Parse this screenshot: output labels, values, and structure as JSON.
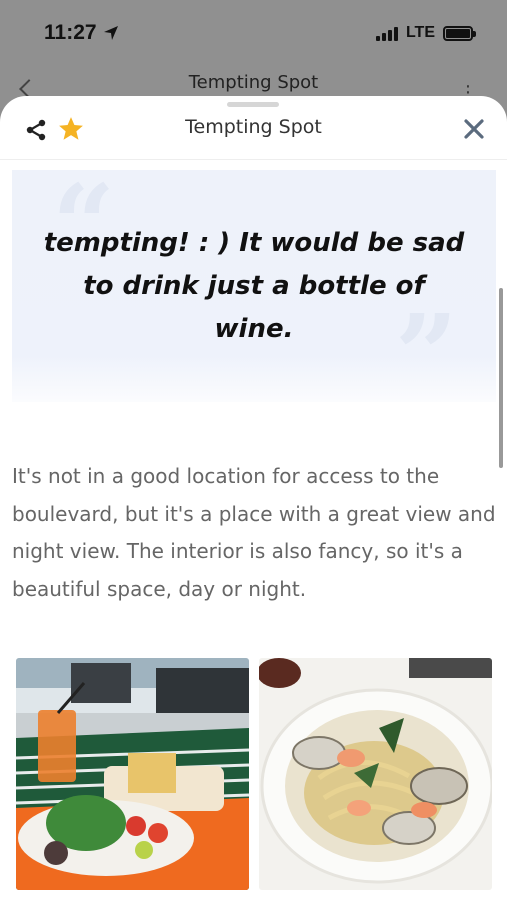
{
  "status_bar": {
    "time": "11:27",
    "network": "LTE"
  },
  "underlying_page": {
    "title": "Tempting Spot"
  },
  "sheet": {
    "title": "Tempting Spot",
    "share_icon": "share-icon",
    "favorite_icon": "star-icon",
    "close_icon": "close-icon",
    "accent_color": "#f5b324"
  },
  "review": {
    "quote": "tempting! : ) It would be sad to drink just a bottle of wine.",
    "description": "It's not in a good location for access to the boulevard, but it's a place with a great view and night view. The interior is also fancy, so it's a beautiful space, day or night."
  },
  "photos": [
    {
      "subject": "salad and drink on terrace table"
    },
    {
      "subject": "seafood pasta with clams and shrimp"
    }
  ]
}
